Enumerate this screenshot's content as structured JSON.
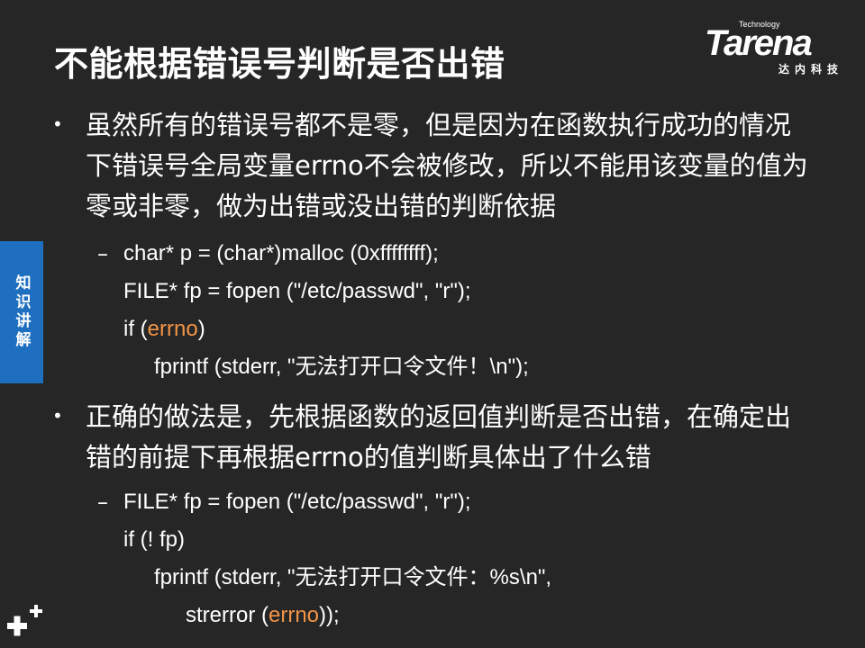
{
  "slide": {
    "title": "不能根据错误号判断是否出错",
    "logo": {
      "tech_label": "Technology",
      "brand": "Tarena",
      "cn": "达内科技"
    },
    "side_tab": "知识讲解",
    "bullets": [
      {
        "text": "虽然所有的错误号都不是零，但是因为在函数执行成功的情况下错误号全局变量errno不会被修改，所以不能用该变量的值为零或非零，做为出错或没出错的判断依据",
        "code": {
          "line1": "char* p = (char*)malloc (0xffffffff);",
          "line2": "FILE* fp = fopen (\"/etc/passwd\", \"r\");",
          "line3_pre": "if (",
          "line3_hl": "errno",
          "line3_post": ")",
          "line4": "fprintf (stderr, \"无法打开口令文件！\\n\");"
        }
      },
      {
        "text": "正确的做法是，先根据函数的返回值判断是否出错，在确定出错的前提下再根据errno的值判断具体出了什么错",
        "code": {
          "line1": "FILE* fp = fopen (\"/etc/passwd\", \"r\");",
          "line2": "if (! fp)",
          "line3": "fprintf (stderr, \"无法打开口令文件：%s\\n\",",
          "line4_pre": "strerror (",
          "line4_hl": "errno",
          "line4_post": "));"
        }
      }
    ],
    "bullet_symbol": "•",
    "dash_symbol": "–",
    "colors": {
      "background": "#262626",
      "highlight": "#f29447",
      "side_tab": "#1f6fc0"
    }
  }
}
